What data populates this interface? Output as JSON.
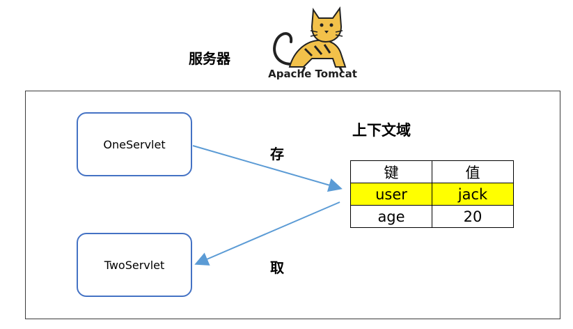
{
  "server": {
    "label": "服务器",
    "logo_text": "Apache Tomcat",
    "logo_icon": "tomcat-cat-icon"
  },
  "servlets": {
    "one": "OneServlet",
    "two": "TwoServlet"
  },
  "context": {
    "title": "上下文域",
    "headers": [
      "键",
      "值"
    ],
    "rows": [
      {
        "key": "user",
        "value": "jack",
        "highlight": true
      },
      {
        "key": "age",
        "value": "20",
        "highlight": false
      }
    ]
  },
  "arrows": {
    "store_label": "存",
    "fetch_label": "取"
  },
  "colors": {
    "box_border": "#4472c4",
    "arrow": "#5b9bd5",
    "highlight": "#ffff00",
    "logo_yellow": "#f2c14a"
  }
}
